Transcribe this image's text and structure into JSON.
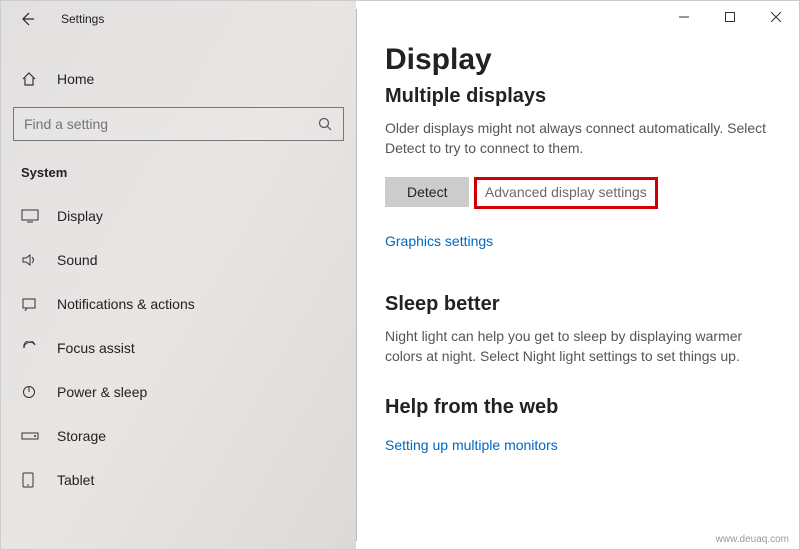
{
  "titlebar": {
    "app_name": "Settings"
  },
  "sidebar": {
    "home_label": "Home",
    "search_placeholder": "Find a setting",
    "section_label": "System",
    "items": [
      {
        "label": "Display"
      },
      {
        "label": "Sound"
      },
      {
        "label": "Notifications & actions"
      },
      {
        "label": "Focus assist"
      },
      {
        "label": "Power & sleep"
      },
      {
        "label": "Storage"
      },
      {
        "label": "Tablet"
      }
    ]
  },
  "content": {
    "title": "Display",
    "subtitle": "Multiple displays",
    "multidisplay_text": "Older displays might not always connect automatically. Select Detect to try to connect to them.",
    "detect_btn": "Detect",
    "adv_link": "Advanced display settings",
    "graphics_link": "Graphics settings",
    "sleep_title": "Sleep better",
    "sleep_text": "Night light can help you get to sleep by displaying warmer colors at night. Select Night light settings to set things up.",
    "help_title": "Help from the web",
    "help_link": "Setting up multiple monitors"
  },
  "watermark": "www.deuaq.com"
}
